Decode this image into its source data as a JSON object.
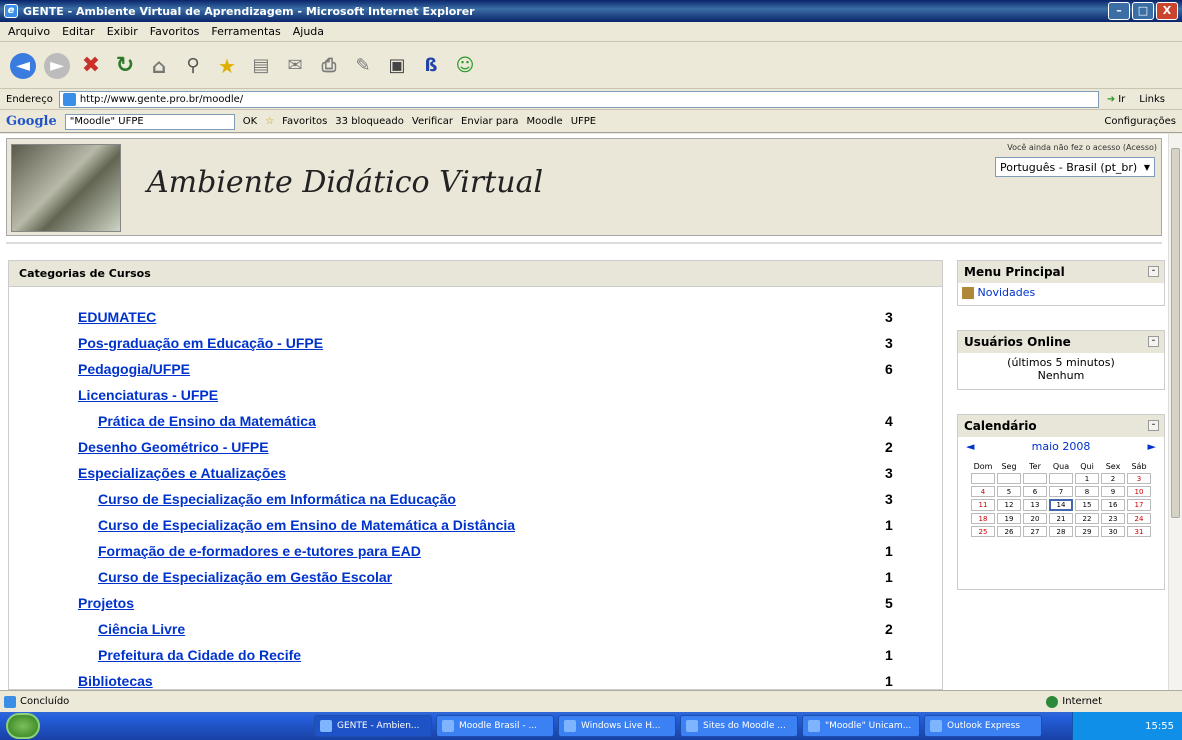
{
  "window": {
    "title": "GENTE - Ambiente Virtual de Aprendizagem - Microsoft Internet Explorer",
    "minimize": "–",
    "maximize": "□",
    "close": "X"
  },
  "menu": [
    "Arquivo",
    "Editar",
    "Exibir",
    "Favoritos",
    "Ferramentas",
    "Ajuda"
  ],
  "address": {
    "label": "Endereço",
    "url": "http://www.gente.pro.br/moodle/",
    "go": "Ir",
    "links": "Links"
  },
  "google": {
    "logo": "Google",
    "query": "\"Moodle\" UFPE",
    "ok": "OK",
    "favoritos": "Favoritos",
    "bloqueado": "33 bloqueado",
    "verificar": "Verificar",
    "enviar": "Enviar para",
    "moodle": "Moodle",
    "ufpe": "UFPE",
    "config": "Configurações"
  },
  "header": {
    "title": "Ambiente Didático Virtual",
    "login_note": "Você ainda não fez o acesso (Acesso)",
    "language": "Português - Brasil (pt_br)"
  },
  "categories": {
    "heading": "Categorias de Cursos",
    "items": [
      {
        "label": "EDUMATEC",
        "count": "3"
      },
      {
        "label": "Pos-graduação em Educação - UFPE",
        "count": "3"
      },
      {
        "label": "Pedagogia/UFPE",
        "count": "6"
      },
      {
        "label": "Licenciaturas - UFPE",
        "count": ""
      },
      {
        "label": "Prática de Ensino da Matemática",
        "count": "4"
      },
      {
        "label": "Desenho Geométrico - UFPE",
        "count": "2"
      },
      {
        "label": "Especializações e Atualizações",
        "count": "3"
      },
      {
        "label": "Curso de Especialização em Informática na Educação",
        "count": "3"
      },
      {
        "label": "Curso de Especialização em Ensino de Matemática a Distância",
        "count": "1"
      },
      {
        "label": "Formação de e-formadores e e-tutores para EAD",
        "count": "1"
      },
      {
        "label": "Curso de Especialização em Gestão Escolar",
        "count": "1"
      },
      {
        "label": "Projetos",
        "count": "5"
      },
      {
        "label": "Ciência Livre",
        "count": "2"
      },
      {
        "label": "Prefeitura da Cidade do Recife",
        "count": "1"
      },
      {
        "label": "Bibliotecas",
        "count": "1"
      }
    ]
  },
  "menu_principal": {
    "heading": "Menu Principal",
    "item": "Novidades",
    "min": "-"
  },
  "online": {
    "heading": "Usuários Online",
    "line1": "(últimos 5 minutos)",
    "line2": "Nenhum",
    "min": "-"
  },
  "calendar": {
    "heading": "Calendário",
    "month": "maio 2008",
    "prev": "◄",
    "next": "►",
    "min": "-",
    "days": [
      "Dom",
      "Seg",
      "Ter",
      "Qua",
      "Qui",
      "Sex",
      "Sáb"
    ],
    "weeks": [
      [
        "",
        "",
        "",
        "",
        "1",
        "2",
        "3"
      ],
      [
        "4",
        "5",
        "6",
        "7",
        "8",
        "9",
        "10"
      ],
      [
        "11",
        "12",
        "13",
        "14",
        "15",
        "16",
        "17"
      ],
      [
        "18",
        "19",
        "20",
        "21",
        "22",
        "23",
        "24"
      ],
      [
        "25",
        "26",
        "27",
        "28",
        "29",
        "30",
        "31"
      ]
    ]
  },
  "status": {
    "text": "Concluído",
    "zone": "Internet"
  },
  "taskbar": {
    "tasks": [
      "GENTE - Ambien...",
      "Moodle Brasil - ...",
      "Windows Live H...",
      "Sites do Moodle ...",
      "\"Moodle\" Unicam...",
      "Outlook Express"
    ],
    "clock": "15:55"
  }
}
